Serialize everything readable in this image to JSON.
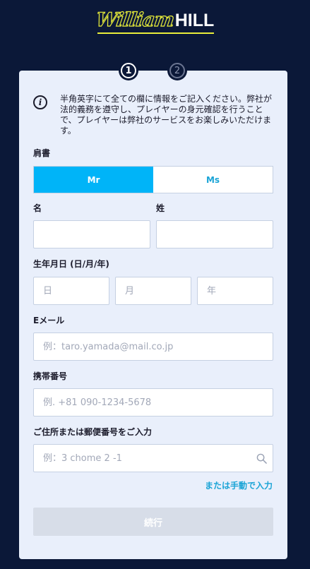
{
  "brand": {
    "script": "William",
    "bold": "HILL",
    "accent": "#e9ee3a",
    "background": "#0b1838"
  },
  "stepper": {
    "steps": [
      {
        "number": "1",
        "state": "active"
      },
      {
        "number": "2",
        "state": "inactive"
      }
    ]
  },
  "info": {
    "icon": "info-icon",
    "text": "半角英字にて全ての欄に情報をご記入ください。弊社が法的義務を遵守し、プレイヤーの身元確認を行うことで、プレイヤーは弊社のサービスをお楽しみいただけます。"
  },
  "form": {
    "title_label": "肩書",
    "title_options": [
      {
        "label": "Mr",
        "selected": true
      },
      {
        "label": "Ms",
        "selected": false
      }
    ],
    "first_name_label": "名",
    "first_name_value": "",
    "last_name_label": "姓",
    "last_name_value": "",
    "dob_label": "生年月日 (日/月/年)",
    "dob_day_placeholder": "日",
    "dob_month_placeholder": "月",
    "dob_year_placeholder": "年",
    "email_label": "Eメール",
    "email_placeholder": "例：taro.yamada@mail.co.jp",
    "phone_label": "携帯番号",
    "phone_placeholder": "例. +81 090-1234-5678",
    "address_label": "ご住所または郵便番号をご入力",
    "address_placeholder": "例：3 chome 2 -1",
    "address_icon": "search-icon",
    "manual_link": "または手動で入力",
    "continue_label": "続行"
  },
  "colors": {
    "selected": "#00b4f8",
    "link": "#1aa4d6",
    "disabled_button": "#d7dde8",
    "card": "#e9effb"
  }
}
